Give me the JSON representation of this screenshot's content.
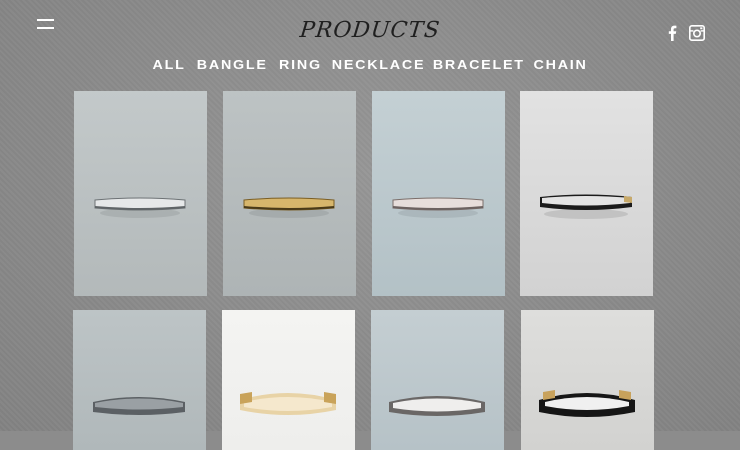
{
  "header": {
    "title": "PRODUCTS",
    "menu_icon": "hamburger-menu-icon",
    "social_icons": [
      "facebook-icon",
      "instagram-icon"
    ]
  },
  "nav": {
    "items": [
      {
        "label": "ALL"
      },
      {
        "label": "BANGLE"
      },
      {
        "label": "RING"
      },
      {
        "label": "NECKLACE"
      },
      {
        "label": "BRACELET"
      },
      {
        "label": "CHAIN"
      }
    ]
  },
  "products": {
    "row1": [
      {
        "bg": "#bcc2c3",
        "band": "silver"
      },
      {
        "bg": "#b6bcbd",
        "band": "gold"
      },
      {
        "bg": "#bccacf",
        "band": "rose-silver"
      },
      {
        "bg": "#dadada",
        "band": "black-silver"
      }
    ],
    "row2": [
      {
        "bg": "#b8c0c2",
        "band": "dark-silver"
      },
      {
        "bg": "#f2f2f0",
        "band": "gold-cream"
      },
      {
        "bg": "#bcc8cd",
        "band": "silver-white"
      },
      {
        "bg": "#d8d8d6",
        "band": "black-gold"
      }
    ]
  }
}
